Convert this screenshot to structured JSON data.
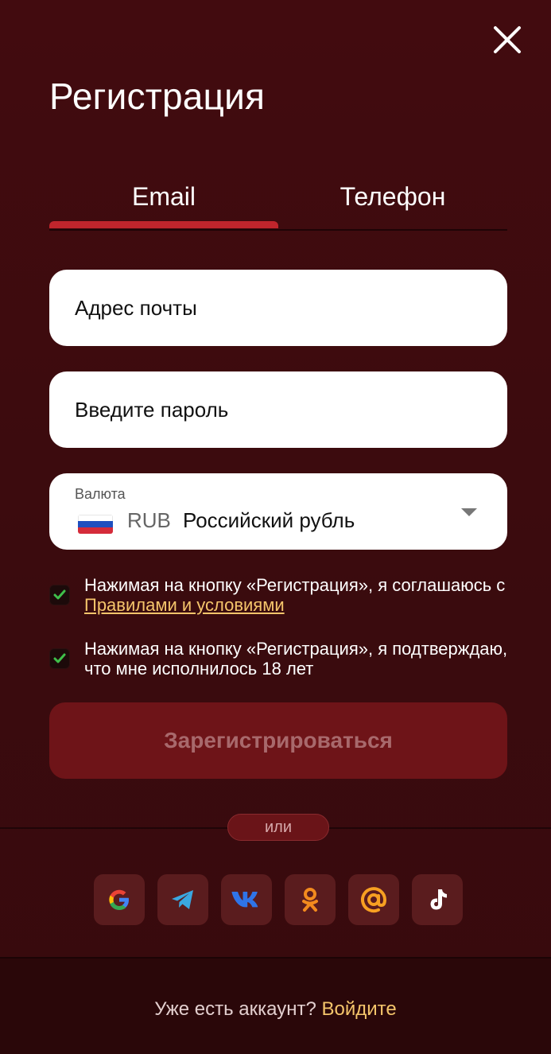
{
  "header": {
    "title": "Регистрация",
    "close_icon": "close-icon"
  },
  "tabs": [
    {
      "label": "Email",
      "active": true
    },
    {
      "label": "Телефон",
      "active": false
    }
  ],
  "form": {
    "email": {
      "placeholder": "Адрес почты",
      "value": ""
    },
    "password": {
      "placeholder": "Введите пароль",
      "value": ""
    },
    "currency": {
      "label": "Валюта",
      "code": "RUB",
      "name": "Российский рубль",
      "flag_icon": "russia-flag-icon"
    },
    "agreements": [
      {
        "checked": true,
        "text": "Нажимая на кнопку «Регистрация», я соглашаюсь с ",
        "link": "Правилами и условиями"
      },
      {
        "checked": true,
        "text": "Нажимая на кнопку «Регистрация», я подтверждаю, что мне исполнилось 18 лет"
      }
    ],
    "submit_label": "Зарегистрироваться"
  },
  "divider": {
    "label": "или"
  },
  "socials": [
    {
      "name": "google",
      "icon": "google-icon"
    },
    {
      "name": "telegram",
      "icon": "telegram-icon"
    },
    {
      "name": "vk",
      "icon": "vk-icon"
    },
    {
      "name": "odnoklassniki",
      "icon": "odnoklassniki-icon"
    },
    {
      "name": "mail",
      "icon": "mail-at-icon"
    },
    {
      "name": "tiktok",
      "icon": "tiktok-icon"
    }
  ],
  "footer": {
    "question": "Уже есть аккаунт? ",
    "login_link": "Войдите"
  },
  "colors": {
    "background": "#3c0b0e",
    "accent_red": "#c0252c",
    "link_gold": "#f5c56b",
    "button_disabled": "#6e1418"
  }
}
